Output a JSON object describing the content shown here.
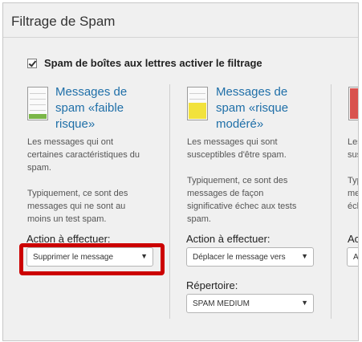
{
  "dialog": {
    "title": "Filtrage de Spam",
    "enable_label": "Spam de boîtes aux lettres activer le filtrage",
    "enable_checked": true
  },
  "columns": [
    {
      "icon": "spam-level-low-icon",
      "fill_color": "#7ab648",
      "title_lines": [
        "Messages de",
        "spam «faible",
        "risque»"
      ],
      "desc_lines": [
        "Les messages qui ont",
        "certaines caractéristiques du",
        "spam.",
        "",
        "Typiquement, ce sont des",
        "messages qui ne sont au",
        "moins un test spam."
      ],
      "action_label": "Action à effectuer:",
      "action_value": "Supprimer le message"
    },
    {
      "icon": "spam-level-medium-icon",
      "fill_color": "#f2e23c",
      "title_lines": [
        "Messages de",
        "spam «risque",
        "modéré»"
      ],
      "desc_lines": [
        "Les messages qui sont",
        "susceptibles d'être spam.",
        "",
        "Typiquement, ce sont des",
        "messages de façon",
        "significative échec aux tests",
        "spam."
      ],
      "action_label": "Action à effectuer:",
      "action_value": "Déplacer le message vers",
      "folder_label": "Répertoire:",
      "folder_value": "SPAM MEDIUM"
    },
    {
      "icon": "spam-level-high-icon",
      "fill_color": "#d9534f",
      "desc_lines": [
        "Les",
        "susc",
        "",
        "Typi",
        "mes",
        "éche"
      ],
      "action_label": "Acti",
      "action_value": "Au"
    }
  ]
}
